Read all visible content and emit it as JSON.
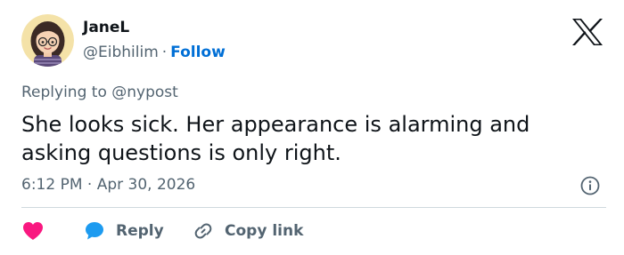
{
  "user": {
    "display_name": "JaneL",
    "handle": "@Eibhilim",
    "separator": "·",
    "follow_label": "Follow"
  },
  "reply_context": {
    "prefix": "Replying to",
    "mention": "@nypost"
  },
  "tweet": {
    "text": "She looks sick. Her appearance is alarming and asking questions is only right.",
    "timestamp": "6:12 PM · Apr 30, 2026"
  },
  "actions": {
    "reply_label": "Reply",
    "copy_link_label": "Copy link"
  },
  "icons": {
    "brand": "x-logo",
    "info": "info-icon",
    "like": "heart-icon",
    "reply": "speech-bubble-icon",
    "copy": "link-icon"
  },
  "colors": {
    "text": "#0f1419",
    "muted": "#536471",
    "follow": "#006fd6",
    "heart": "#f91880",
    "reply_bubble": "#1d9bf0",
    "divider": "#cfd9de"
  }
}
